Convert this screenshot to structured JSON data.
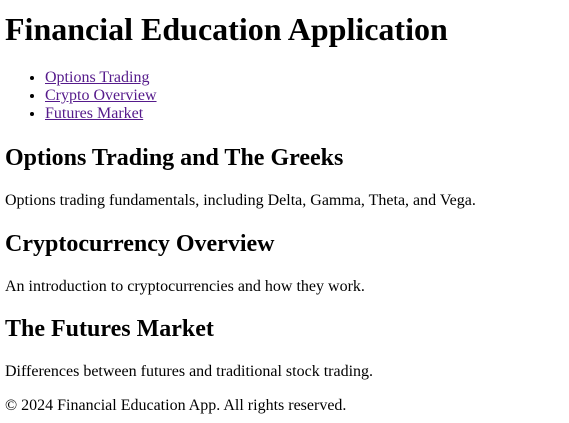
{
  "page": {
    "title": "Financial Education Application"
  },
  "nav": {
    "items": [
      {
        "label": "Options Trading"
      },
      {
        "label": "Crypto Overview"
      },
      {
        "label": "Futures Market"
      }
    ]
  },
  "sections": {
    "options": {
      "heading": "Options Trading and The Greeks",
      "text": "Options trading fundamentals, including Delta, Gamma, Theta, and Vega."
    },
    "crypto": {
      "heading": "Cryptocurrency Overview",
      "text": "An introduction to cryptocurrencies and how they work."
    },
    "futures": {
      "heading": "The Futures Market",
      "text": "Differences between futures and traditional stock trading."
    }
  },
  "footer": {
    "text": "© 2024 Financial Education App. All rights reserved."
  },
  "colors": {
    "link_visited": "#551a8b",
    "text": "#000000",
    "background": "#ffffff"
  }
}
